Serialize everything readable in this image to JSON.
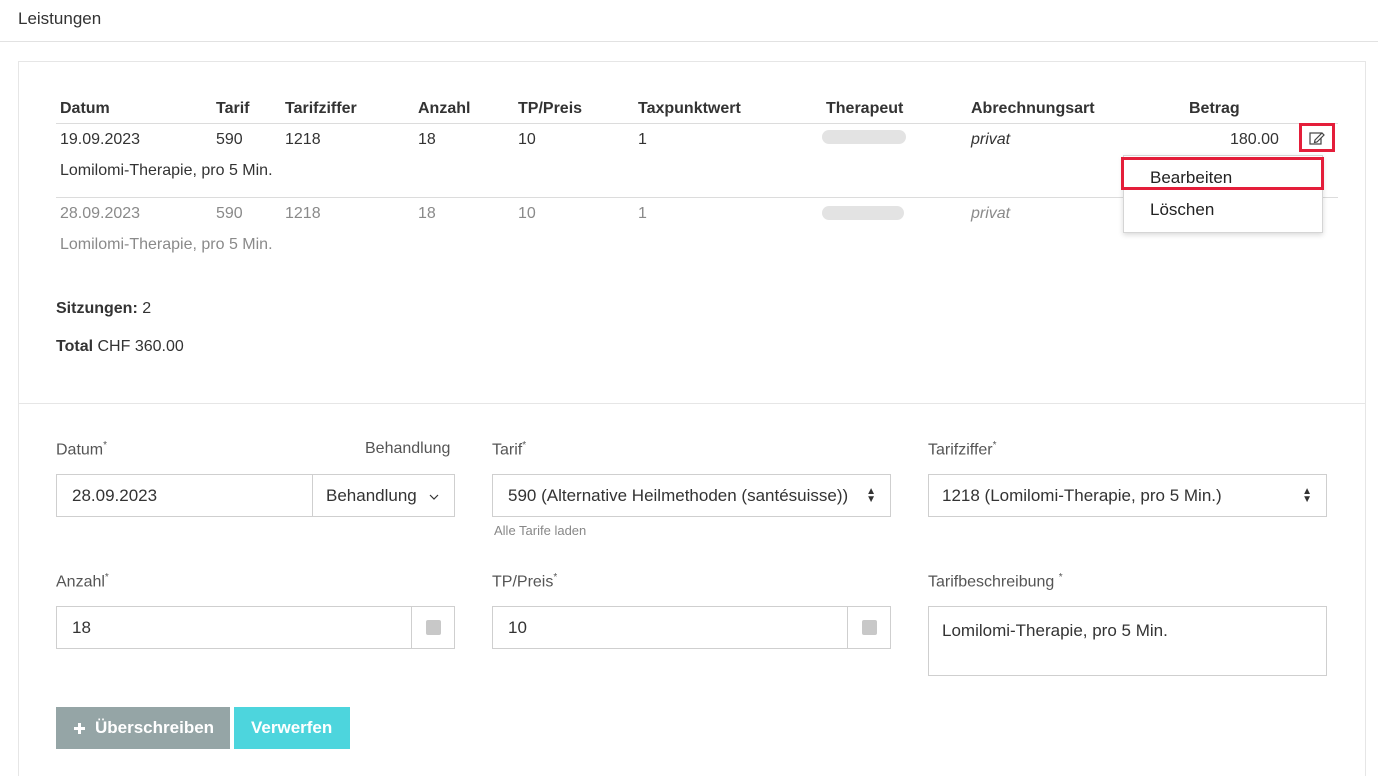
{
  "header": {
    "title": "Leistungen"
  },
  "table": {
    "columns": [
      "Datum",
      "Tarif",
      "Tarifziffer",
      "Anzahl",
      "TP/Preis",
      "Taxpunktwert",
      "Therapeut",
      "Abrechnungsart",
      "Betrag"
    ],
    "rows": [
      {
        "datum": "19.09.2023",
        "tarif": "590",
        "tarifziffer": "1218",
        "anzahl": "18",
        "tp_preis": "10",
        "taxpunktwert": "1",
        "abrechnungsart": "privat",
        "betrag": "180.00",
        "beschreibung": "Lomilomi-Therapie, pro 5 Min."
      },
      {
        "datum": "28.09.2023",
        "tarif": "590",
        "tarifziffer": "1218",
        "anzahl": "18",
        "tp_preis": "10",
        "taxpunktwert": "1",
        "abrechnungsart": "privat",
        "betrag": "",
        "beschreibung": "Lomilomi-Therapie, pro 5 Min."
      }
    ]
  },
  "row_menu": {
    "items": [
      "Bearbeiten",
      "Löschen"
    ],
    "highlight_color": "#e41e3a"
  },
  "summary": {
    "sessions_label": "Sitzungen:",
    "sessions_value": "2",
    "total_label": "Total",
    "total_value": "CHF 360.00"
  },
  "form": {
    "datum": {
      "label": "Datum",
      "required": "*",
      "value": "28.09.2023"
    },
    "behandlung": {
      "label": "Behandlung",
      "button": "Behandlung"
    },
    "tarif": {
      "label": "Tarif",
      "required": "*",
      "value": "590 (Alternative Heilmethoden (santésuisse))",
      "hint": "Alle Tarife laden"
    },
    "tarifziffer": {
      "label": "Tarifziffer",
      "required": "*",
      "value": "1218 (Lomilomi-Therapie, pro 5 Min.)"
    },
    "anzahl": {
      "label": "Anzahl",
      "required": "*",
      "value": "18"
    },
    "tp_preis": {
      "label": "TP/Preis",
      "required": "*",
      "value": "10"
    },
    "tarifbeschreibung": {
      "label": "Tarifbeschreibung",
      "required": "*",
      "value": "Lomilomi-Therapie, pro 5 Min."
    }
  },
  "buttons": {
    "overwrite": "Überschreiben",
    "discard": "Verwerfen"
  },
  "colors": {
    "overwrite_bg": "#95a5a6",
    "discard_bg": "#4dd5dd"
  },
  "icons": {
    "edit": "edit-icon",
    "plus": "plus-icon",
    "chevron": "chevron-down-icon",
    "sort": "select-arrows-icon"
  }
}
